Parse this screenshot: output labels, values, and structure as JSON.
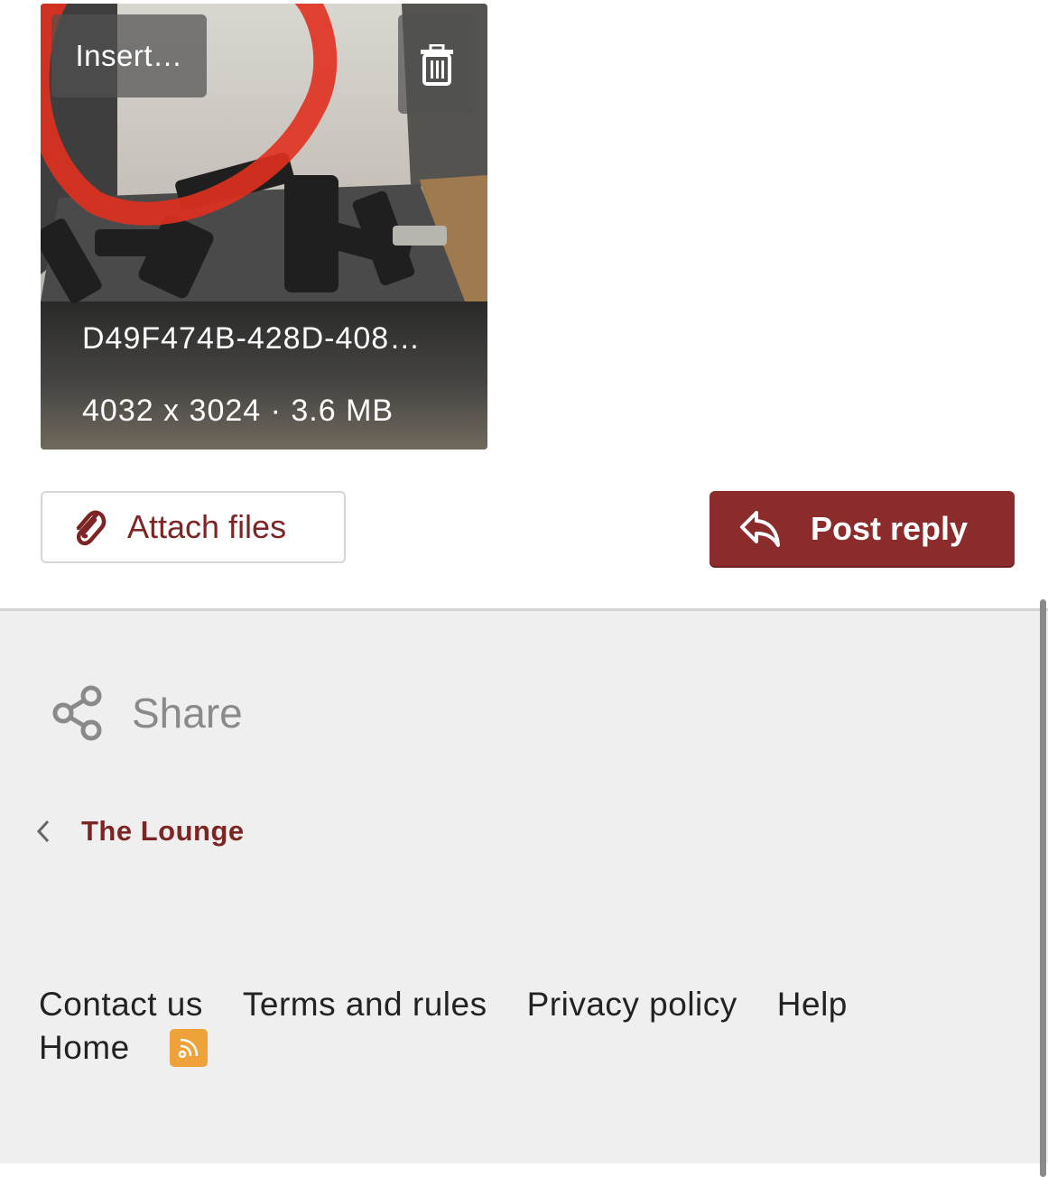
{
  "attachment": {
    "insert_label": "Insert…",
    "file_name": "D49F474B-428D-408…",
    "file_meta": "4032 x 3024 · 3.6 MB"
  },
  "actions": {
    "attach_files_label": "Attach files",
    "post_reply_label": "Post reply"
  },
  "share": {
    "label": "Share"
  },
  "breadcrumb": {
    "label": "The Lounge"
  },
  "footer": {
    "links": [
      "Contact us",
      "Terms and rules",
      "Privacy policy",
      "Help",
      "Home"
    ]
  },
  "colors": {
    "brand": "#8b2b2b",
    "link": "#7d2424",
    "footer_bg": "#efefef",
    "rss": "#f0a23a"
  },
  "icons": {
    "delete": "trash-icon",
    "attach": "paperclip-icon",
    "reply": "reply-arrow-icon",
    "share": "share-icon",
    "back": "chevron-left-icon",
    "feed": "rss-icon"
  }
}
